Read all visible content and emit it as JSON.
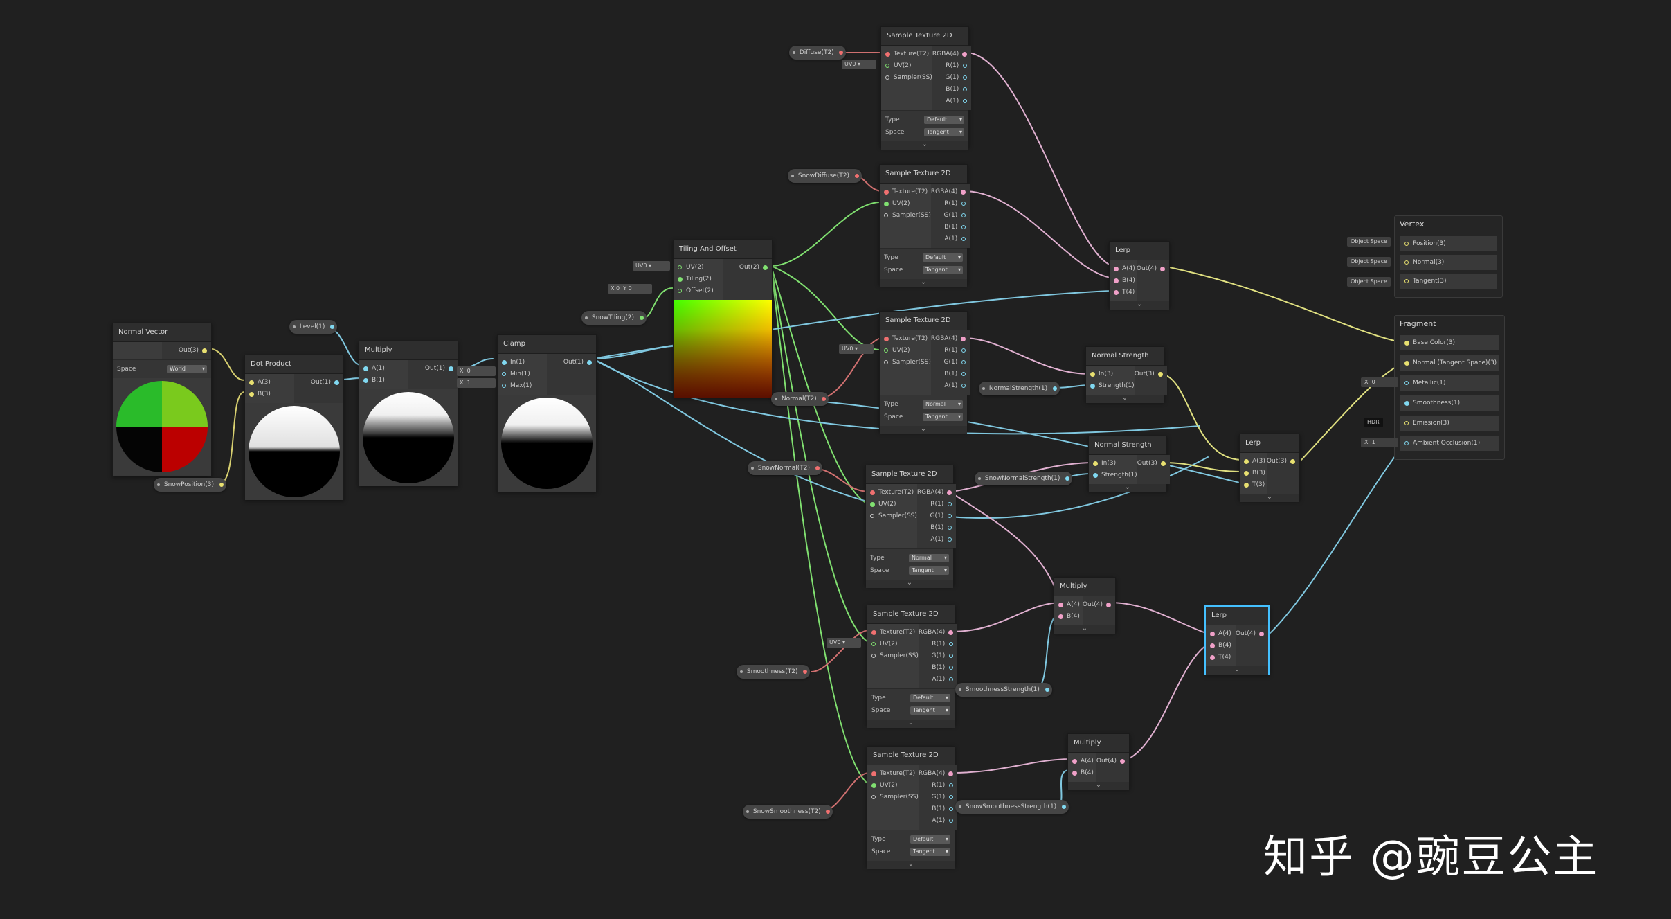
{
  "canvas": {
    "background": "#202020"
  },
  "nodes": {
    "normal_vector": {
      "title": "Normal Vector",
      "output": "Out(3)",
      "space_label": "Space",
      "space_value": "World"
    },
    "dot_product": {
      "title": "Dot Product",
      "inputs": [
        "A(3)",
        "B(3)"
      ],
      "output": "Out(1)"
    },
    "multiply1": {
      "title": "Multiply",
      "inputs": [
        "A(1)",
        "B(1)"
      ],
      "output": "Out(1)"
    },
    "clamp": {
      "title": "Clamp",
      "inputs": [
        "In(1)",
        "Min(1)",
        "Max(1)"
      ],
      "output": "Out(1)",
      "min_label": "X",
      "min_value": "0",
      "max_label": "X",
      "max_value": "1"
    },
    "tiling": {
      "title": "Tiling And Offset",
      "inputs": [
        "UV(2)",
        "Tiling(2)",
        "Offset(2)"
      ],
      "output": "Out(2)",
      "uv_value": "UV0",
      "tiling_x_label": "X",
      "tiling_x": "0",
      "tiling_y_label": "Y",
      "tiling_y": "0"
    },
    "tex_diffuse": {
      "title": "Sample Texture 2D",
      "inputs": [
        "Texture(T2)",
        "UV(2)",
        "Sampler(SS)"
      ],
      "outputs": [
        "RGBA(4)",
        "R(1)",
        "G(1)",
        "B(1)",
        "A(1)"
      ],
      "type_label": "Type",
      "type_value": "Default",
      "space_label": "Space",
      "space_value": "Tangent",
      "uv_value": "UV0"
    },
    "tex_snowdiffuse": {
      "title": "Sample Texture 2D",
      "inputs": [
        "Texture(T2)",
        "UV(2)",
        "Sampler(SS)"
      ],
      "outputs": [
        "RGBA(4)",
        "R(1)",
        "G(1)",
        "B(1)",
        "A(1)"
      ],
      "type_label": "Type",
      "type_value": "Default",
      "space_label": "Space",
      "space_value": "Tangent"
    },
    "tex_normal": {
      "title": "Sample Texture 2D",
      "inputs": [
        "Texture(T2)",
        "UV(2)",
        "Sampler(SS)"
      ],
      "outputs": [
        "RGBA(4)",
        "R(1)",
        "G(1)",
        "B(1)",
        "A(1)"
      ],
      "type_label": "Type",
      "type_value": "Normal",
      "space_label": "Space",
      "space_value": "Tangent",
      "uv_value": "UV0"
    },
    "tex_snownormal": {
      "title": "Sample Texture 2D",
      "inputs": [
        "Texture(T2)",
        "UV(2)",
        "Sampler(SS)"
      ],
      "outputs": [
        "RGBA(4)",
        "R(1)",
        "G(1)",
        "B(1)",
        "A(1)"
      ],
      "type_label": "Type",
      "type_value": "Normal",
      "space_label": "Space",
      "space_value": "Tangent"
    },
    "tex_smooth": {
      "title": "Sample Texture 2D",
      "inputs": [
        "Texture(T2)",
        "UV(2)",
        "Sampler(SS)"
      ],
      "outputs": [
        "RGBA(4)",
        "R(1)",
        "G(1)",
        "B(1)",
        "A(1)"
      ],
      "type_label": "Type",
      "type_value": "Default",
      "space_label": "Space",
      "space_value": "Tangent",
      "uv_value": "UV0"
    },
    "tex_snowsmooth": {
      "title": "Sample Texture 2D",
      "inputs": [
        "Texture(T2)",
        "UV(2)",
        "Sampler(SS)"
      ],
      "outputs": [
        "RGBA(4)",
        "R(1)",
        "G(1)",
        "B(1)",
        "A(1)"
      ],
      "type_label": "Type",
      "type_value": "Default",
      "space_label": "Space",
      "space_value": "Tangent"
    },
    "lerp1": {
      "title": "Lerp",
      "inputs": [
        "A(4)",
        "B(4)",
        "T(4)"
      ],
      "output": "Out(4)"
    },
    "normstr1": {
      "title": "Normal Strength",
      "inputs": [
        "In(3)",
        "Strength(1)"
      ],
      "output": "Out(3)"
    },
    "normstr2": {
      "title": "Normal Strength",
      "inputs": [
        "In(3)",
        "Strength(1)"
      ],
      "output": "Out(3)"
    },
    "lerp2": {
      "title": "Lerp",
      "inputs": [
        "A(3)",
        "B(3)",
        "T(3)"
      ],
      "output": "Out(3)"
    },
    "multiply2": {
      "title": "Multiply",
      "inputs": [
        "A(4)",
        "B(4)"
      ],
      "output": "Out(4)"
    },
    "multiply3": {
      "title": "Multiply",
      "inputs": [
        "A(4)",
        "B(4)"
      ],
      "output": "Out(4)"
    },
    "lerp3": {
      "title": "Lerp",
      "inputs": [
        "A(4)",
        "B(4)",
        "T(4)"
      ],
      "output": "Out(4)"
    }
  },
  "properties": {
    "diffuse": "Diffuse(T2)",
    "snow_diffuse": "SnowDiffuse(T2)",
    "level": "Level(1)",
    "snow_position": "SnowPosition(3)",
    "snow_tiling": "SnowTiling(2)",
    "normal": "Normal(T2)",
    "normal_strength": "NormalStrength(1)",
    "snow_normal": "SnowNormal(T2)",
    "snow_normal_strength": "SnowNormalStrength(1)",
    "smoothness": "Smoothness(T2)",
    "smoothness_strength": "SmoothnessStrength(1)",
    "snow_smoothness": "SnowSmoothness(T2)",
    "snow_smoothness_strength": "SnowSmoothnessStrength(1)"
  },
  "master": {
    "vertex_title": "Vertex",
    "vertex_rows": [
      "Position(3)",
      "Normal(3)",
      "Tangent(3)"
    ],
    "vertex_space": "Object Space",
    "fragment_title": "Fragment",
    "fragment_rows": [
      "Base Color(3)",
      "Normal (Tangent Space)(3)",
      "Metallic(1)",
      "Smoothness(1)",
      "Emission(3)",
      "Ambient Occlusion(1)"
    ],
    "metallic_label": "X",
    "metallic_value": "0",
    "emission_label": "HDR",
    "ao_label": "X",
    "ao_value": "1"
  },
  "watermark": "知乎 @豌豆公主",
  "colors": {
    "texture_port": "#f07070",
    "vector4_port": "#f0a0c8",
    "vector3_port": "#e8e070",
    "vector2_port": "#80e070",
    "vector1_port": "#80d8f0",
    "selection": "#44c0ff"
  }
}
